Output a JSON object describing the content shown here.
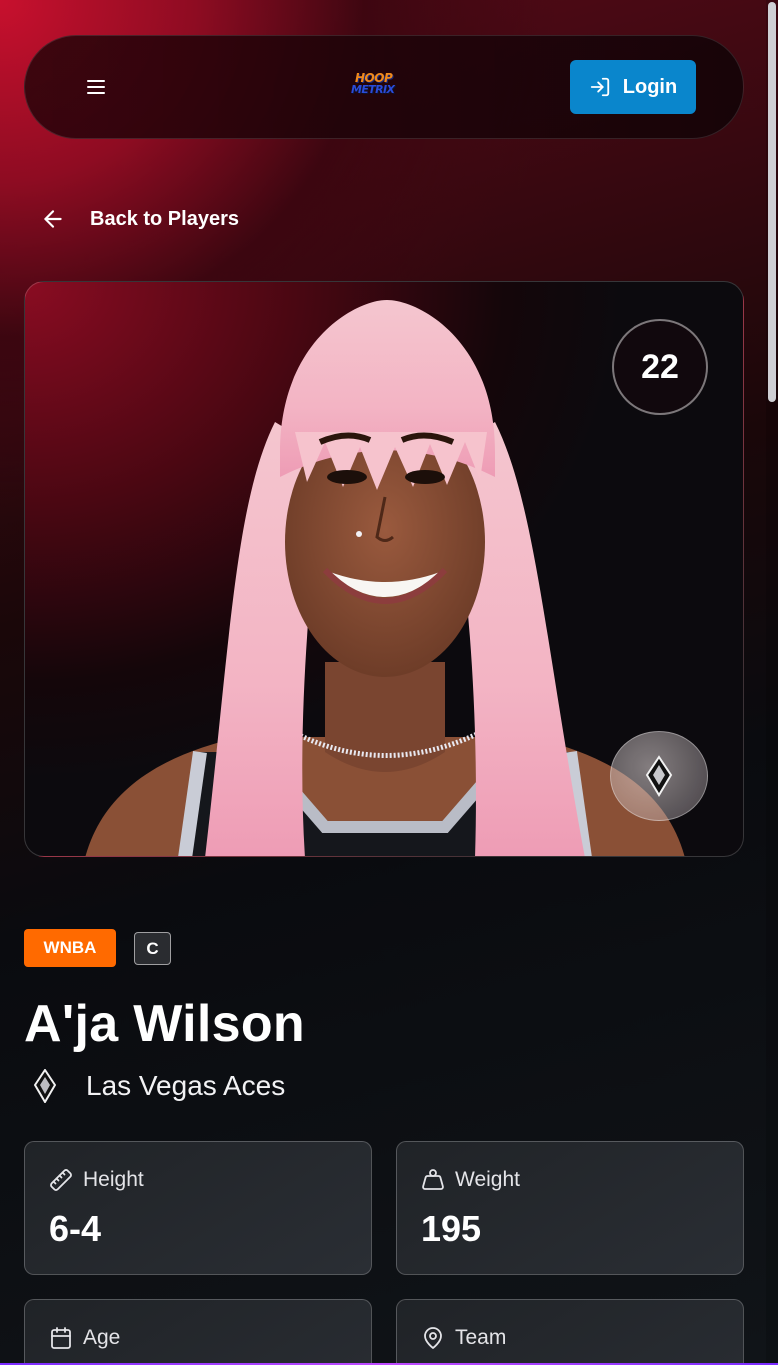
{
  "nav": {
    "logo_top": "HOOP",
    "logo_bottom": "METRIX",
    "login_label": "Login"
  },
  "back": {
    "label": "Back to Players"
  },
  "player": {
    "jersey_number": "22",
    "league": "WNBA",
    "position": "C",
    "name": "A'ja Wilson",
    "team": "Las Vegas Aces"
  },
  "stats": [
    {
      "label": "Height",
      "value": "6-4",
      "icon": "ruler-icon"
    },
    {
      "label": "Weight",
      "value": "195",
      "icon": "weight-icon"
    },
    {
      "label": "Age",
      "value": "",
      "icon": "calendar-icon"
    },
    {
      "label": "Team",
      "value": "",
      "icon": "map-pin-icon"
    }
  ],
  "colors": {
    "accent_red": "#c8102e",
    "login_blue": "#0a86cc",
    "league_orange": "#ff6a00"
  }
}
